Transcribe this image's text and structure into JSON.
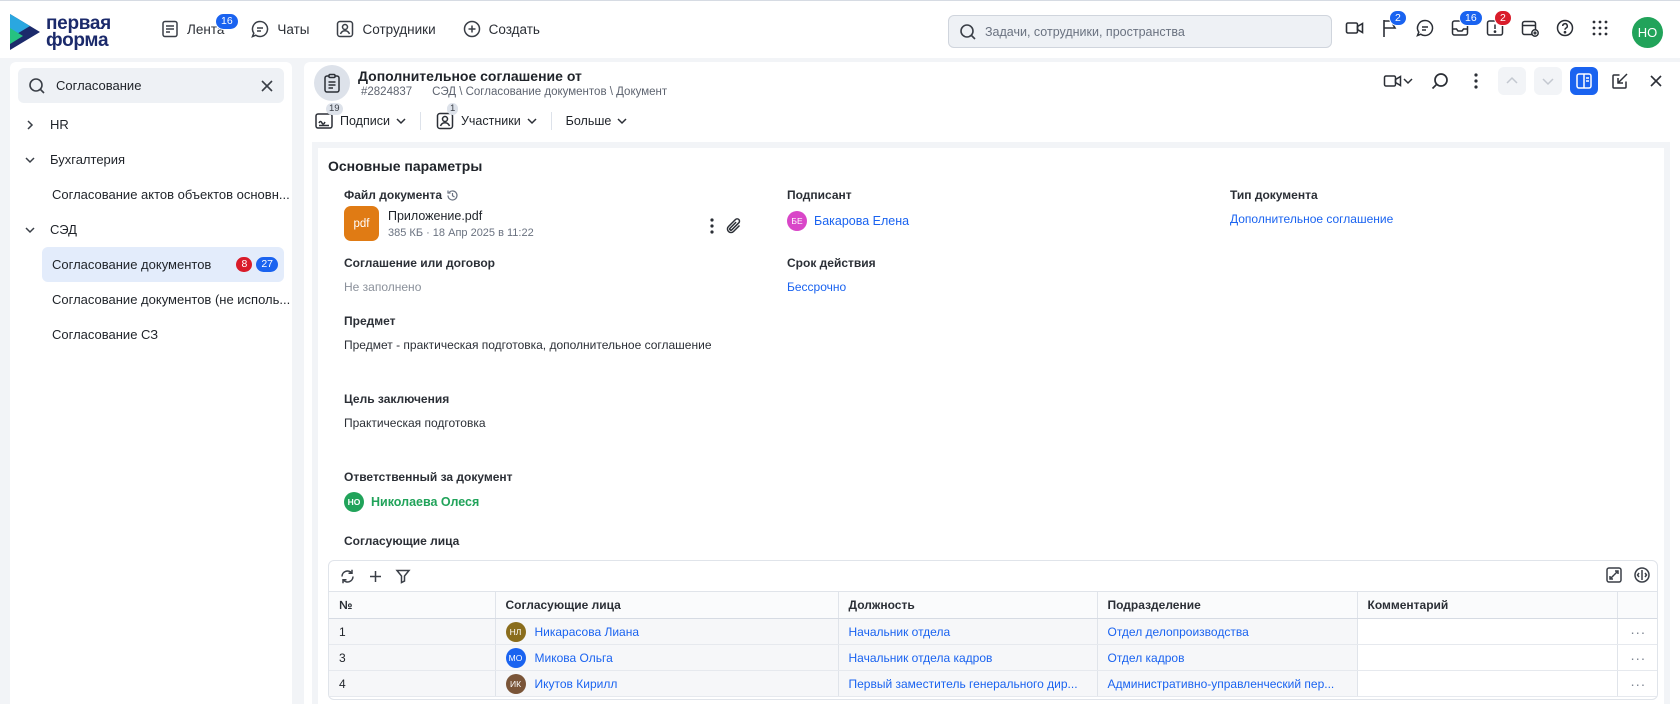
{
  "app": {
    "logo_line1": "первая",
    "logo_line2": "форма"
  },
  "topnav": [
    {
      "label": "Лента",
      "badge": "16"
    },
    {
      "label": "Чаты",
      "badge": ""
    },
    {
      "label": "Сотрудники",
      "badge": ""
    },
    {
      "label": "Создать",
      "badge": ""
    }
  ],
  "global_search": {
    "placeholder": "Задачи, сотрудники, пространства"
  },
  "top_icons": {
    "flag_badge": "2",
    "inbox_badge": "16",
    "alert_badge": "2"
  },
  "user": {
    "initials": "НО",
    "color": "#21a35a"
  },
  "sidebar": {
    "search_value": "Согласование",
    "items": [
      {
        "label": "HR",
        "expanded": false
      },
      {
        "label": "Бухгалтерия",
        "expanded": true
      },
      {
        "label": "Согласование актов объектов основн..."
      },
      {
        "label": "СЭД",
        "expanded": true
      },
      {
        "label": "Согласование документов",
        "badge_red": "8",
        "badge_blue": "27",
        "active": true
      },
      {
        "label": "Согласование документов (не исполь..."
      },
      {
        "label": "Согласование СЗ"
      }
    ]
  },
  "document": {
    "title": "Дополнительное соглашение от",
    "id": "#2824837",
    "path": "СЭД \\ Согласование документов \\ Документ",
    "tabs": [
      {
        "label": "Подписи",
        "count": "19"
      },
      {
        "label": "Участники",
        "count": "1"
      },
      {
        "label": "Больше",
        "count": ""
      }
    ],
    "section_title": "Основные параметры",
    "fields": {
      "file_label": "Файл документа",
      "file_type": "pdf",
      "file_name": "Приложение.pdf",
      "file_meta": "385 КБ · 18 Апр 2025 в 11:22",
      "signer_label": "Подписант",
      "signer_initials": "БЕ",
      "signer_name": "Бакарова Елена",
      "doc_type_label": "Тип документа",
      "doc_type_value": "Дополнительное соглашение",
      "agreement_label": "Соглашение или договор",
      "agreement_value": "Не заполнено",
      "validity_label": "Срок действия",
      "validity_value": "Бессрочно",
      "subject_label": "Предмет",
      "subject_value": "Предмет - практическая подготовка, дополнительное соглашение",
      "goal_label": "Цель заключения",
      "goal_value": "Практическая подготовка",
      "responsible_label": "Ответственный за документ",
      "responsible_initials": "НО",
      "responsible_name": "Николаева Олеся",
      "approvers_label": "Согласующие лица"
    },
    "table": {
      "columns": [
        "№",
        "Согласующие лица",
        "Должность",
        "Подразделение",
        "Комментарий"
      ],
      "rows": [
        {
          "num": "1",
          "initials": "НЛ",
          "avatar_color": "#8a6d1c",
          "name": "Никарасова Лиана",
          "position": "Начальник отдела",
          "dept": "Отдел делопроизводства",
          "comment": "",
          "more": "···"
        },
        {
          "num": "3",
          "initials": "МО",
          "avatar_color": "#1a63f0",
          "name": "Микова Ольга",
          "position": "Начальник отдела кадров",
          "dept": "Отдел кадров",
          "comment": "",
          "more": "···"
        },
        {
          "num": "4",
          "initials": "ИК",
          "avatar_color": "#7a5538",
          "name": "Икутов Кирилл",
          "position": "Первый заместитель генерального дир...",
          "dept": "Административно-управленческий пер...",
          "comment": "",
          "more": "···"
        }
      ]
    }
  }
}
